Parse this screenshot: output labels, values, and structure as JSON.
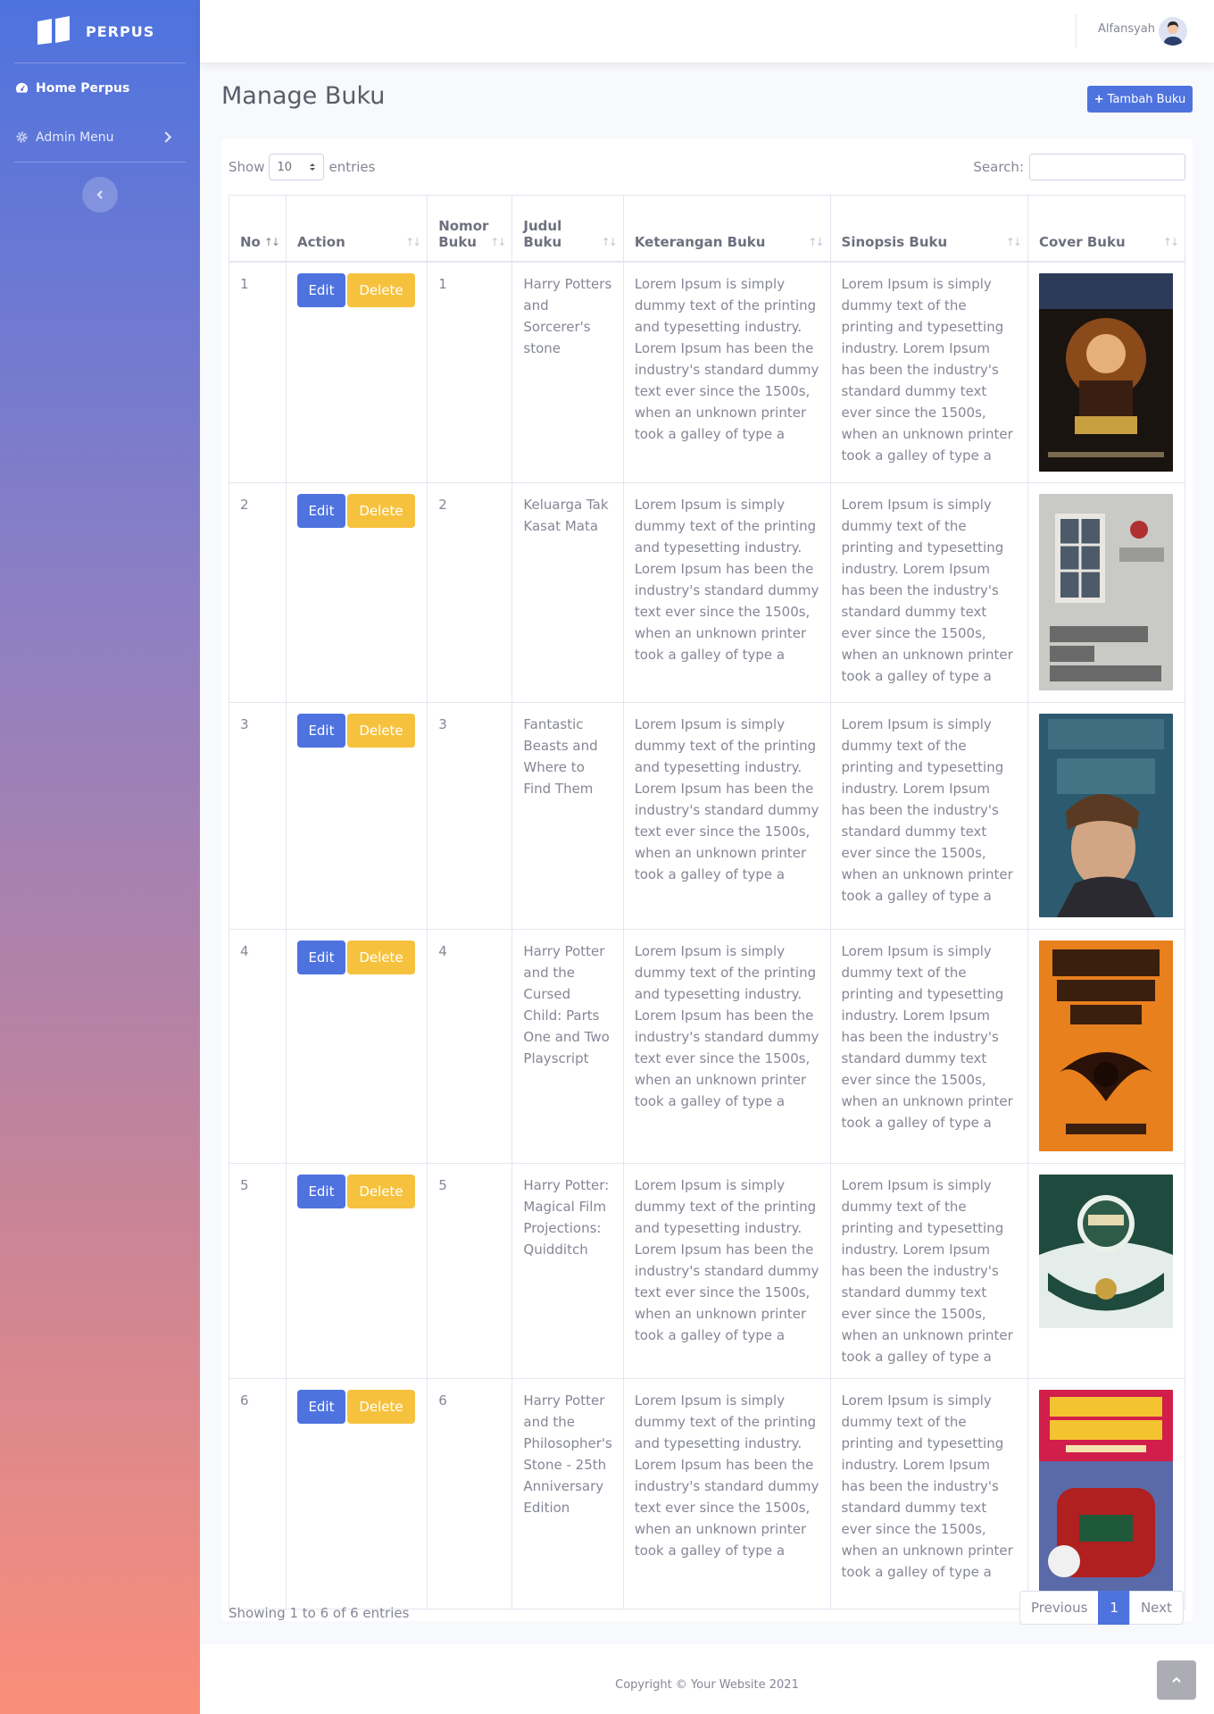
{
  "sidebar": {
    "brand": "PERPUS",
    "items": [
      {
        "label": "Home Perpus"
      },
      {
        "label": "Admin Menu"
      }
    ]
  },
  "topbar": {
    "user_name": "Alfansyah"
  },
  "page": {
    "title": "Manage Buku",
    "add_button": "Tambah Buku"
  },
  "datatable": {
    "show_label": "Show",
    "length_value": "10",
    "entries_label": "entries",
    "search_label": "Search:",
    "search_value": "",
    "info": "Showing 1 to 6 of 6 entries",
    "pagination": {
      "previous": "Previous",
      "current": "1",
      "next": "Next"
    }
  },
  "table": {
    "headers": [
      "No",
      "Action",
      "Nomor Buku",
      "Judul Buku",
      "Keterangan Buku",
      "Sinopsis Buku",
      "Cover Buku"
    ],
    "edit_label": "Edit",
    "delete_label": "Delete",
    "rows": [
      {
        "no": "1",
        "nomor": "1",
        "judul": "Harry Potters and Sorcerer's stone",
        "keterangan": "Lorem Ipsum is simply dummy text of the printing and typesetting industry. Lorem Ipsum has been the industry's standard dummy text ever since the 1500s, when an unknown printer took a galley of type a",
        "sinopsis": "Lorem Ipsum is simply dummy text of the printing and typesetting industry. Lorem Ipsum has been the industry's standard dummy text ever since the 1500s, when an unknown printer took a galley of type a"
      },
      {
        "no": "2",
        "nomor": "2",
        "judul": "Keluarga Tak Kasat Mata",
        "keterangan": "Lorem Ipsum is simply dummy text of the printing and typesetting industry. Lorem Ipsum has been the industry's standard dummy text ever since the 1500s, when an unknown printer took a galley of type a",
        "sinopsis": "Lorem Ipsum is simply dummy text of the printing and typesetting industry. Lorem Ipsum has been the industry's standard dummy text ever since the 1500s, when an unknown printer took a galley of type a"
      },
      {
        "no": "3",
        "nomor": "3",
        "judul": "Fantastic Beasts and Where to Find Them",
        "keterangan": "Lorem Ipsum is simply dummy text of the printing and typesetting industry. Lorem Ipsum has been the industry's standard dummy text ever since the 1500s, when an unknown printer took a galley of type a",
        "sinopsis": "Lorem Ipsum is simply dummy text of the printing and typesetting industry. Lorem Ipsum has been the industry's standard dummy text ever since the 1500s, when an unknown printer took a galley of type a"
      },
      {
        "no": "4",
        "nomor": "4",
        "judul": "Harry Potter and the Cursed Child: Parts One and Two Playscript",
        "keterangan": "Lorem Ipsum is simply dummy text of the printing and typesetting industry. Lorem Ipsum has been the industry's standard dummy text ever since the 1500s, when an unknown printer took a galley of type a",
        "sinopsis": "Lorem Ipsum is simply dummy text of the printing and typesetting industry. Lorem Ipsum has been the industry's standard dummy text ever since the 1500s, when an unknown printer took a galley of type a"
      },
      {
        "no": "5",
        "nomor": "5",
        "judul": "Harry Potter: Magical Film Projections: Quidditch",
        "keterangan": "Lorem Ipsum is simply dummy text of the printing and typesetting industry. Lorem Ipsum has been the industry's standard dummy text ever since the 1500s, when an unknown printer took a galley of type a",
        "sinopsis": "Lorem Ipsum is simply dummy text of the printing and typesetting industry. Lorem Ipsum has been the industry's standard dummy text ever since the 1500s, when an unknown printer took a galley of type a"
      },
      {
        "no": "6",
        "nomor": "6",
        "judul": "Harry Potter and the Philosopher's Stone - 25th Anniversary Edition",
        "keterangan": "Lorem Ipsum is simply dummy text of the printing and typesetting industry. Lorem Ipsum has been the industry's standard dummy text ever since the 1500s, when an unknown printer took a galley of type a",
        "sinopsis": "Lorem Ipsum is simply dummy text of the printing and typesetting industry. Lorem Ipsum has been the industry's standard dummy text ever since the 1500s, when an unknown printer took a galley of type a"
      }
    ]
  },
  "footer": {
    "copyright": "Copyright © Your Website 2021"
  },
  "colors": {
    "primary": "#4e73df",
    "warning": "#f6c23e",
    "sidebar_top": "#4e73df",
    "sidebar_bottom": "#fb8e7a"
  },
  "icons": {
    "brand": "book-open-icon",
    "home": "tachometer-icon",
    "admin": "cog-icon",
    "sidebar_toggle": "chevron-left-icon",
    "scroll_top": "chevron-up-icon"
  }
}
